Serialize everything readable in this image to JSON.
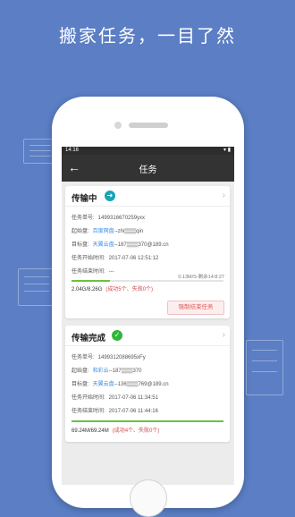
{
  "promo": {
    "headline": "搬家任务，一目了然"
  },
  "status_bar": {
    "time": "14:16",
    "signal": "▾ ▮"
  },
  "nav": {
    "back_icon": "arrow-left-icon",
    "title": "任务"
  },
  "labels": {
    "task_id": "任务单号:",
    "source": "起始盘:",
    "target": "目标盘:",
    "start_time": "任务开始时间:",
    "end_time": "任务结束时间:"
  },
  "cards": [
    {
      "title": "传输中",
      "status_icon": "arrow-right-icon",
      "status_color": "#19a3b5",
      "task_id": "1499316670259yxx",
      "source_service": "百度网盘",
      "source_account": "--zhi▒▒▒qin",
      "target_service": "天翼云盘",
      "target_account": "--187▒▒▒370@189.cn",
      "start_time": "2017-07-06 12:51:12",
      "end_time": "---",
      "speed": "0.13M/S",
      "remaining": "-剩余14:8:27",
      "progress_fraction": 0.25,
      "transferred": "2.04G/8.26G",
      "result": "(成功5个、失败0个)",
      "stop_button": "强制结束任务"
    },
    {
      "title": "传输完成",
      "status_icon": "check-icon",
      "status_color": "#2fb63b",
      "task_id": "1499312088695xFy",
      "source_service": "和彩云",
      "source_account": "--187▒▒▒370",
      "target_service": "天翼云盘",
      "target_account": "--136▒▒▒769@189.cn",
      "start_time": "2017-07-06 11:34:51",
      "end_time": "2017-07-06 11:44:16",
      "progress_fraction": 1.0,
      "transferred": "69.24M/69.24M",
      "result": "(成功4个、失败0个)"
    }
  ]
}
